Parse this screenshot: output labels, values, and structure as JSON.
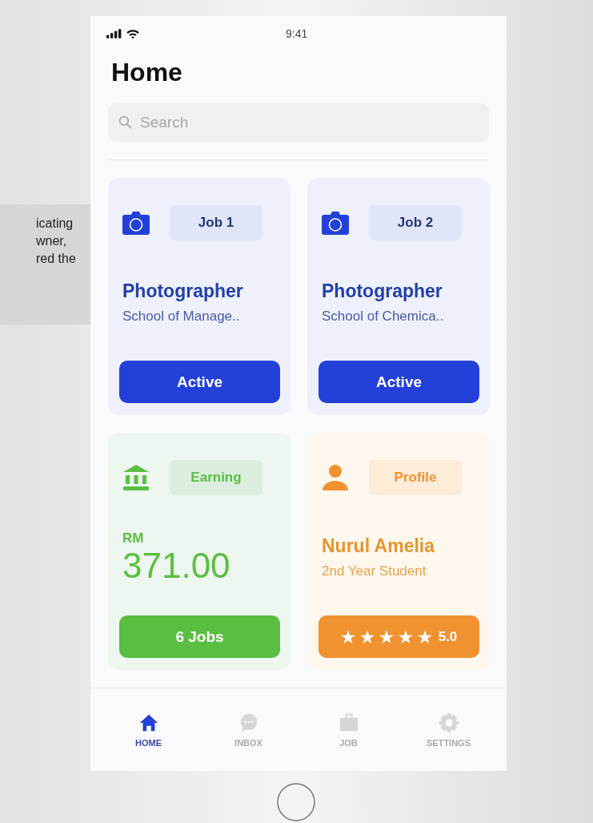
{
  "callout": {
    "lines": [
      "icating",
      "wner,",
      "red the"
    ]
  },
  "status_bar": {
    "time": "9:41"
  },
  "title": "Home",
  "search": {
    "placeholder": "Search"
  },
  "cards": [
    {
      "kind": "job",
      "tag": "Job 1",
      "title": "Photographer",
      "subtitle": "School of Manage..",
      "button": "Active",
      "color": "#2340d8"
    },
    {
      "kind": "job",
      "tag": "Job 2",
      "title": "Photographer",
      "subtitle": "School of Chemica..",
      "button": "Active",
      "color": "#2340d8"
    },
    {
      "kind": "earning",
      "tag": "Earning",
      "currency": "RM",
      "amount": "371.00",
      "button": "6 Jobs",
      "color": "#5abf41"
    },
    {
      "kind": "profile",
      "tag": "Profile",
      "title": "Nurul Amelia",
      "subtitle": "2nd Year Student",
      "stars": 5,
      "rating": "5.0",
      "color": "#f0922f"
    }
  ],
  "nav": [
    {
      "label": "HOME",
      "selected": true
    },
    {
      "label": "INBOX",
      "selected": false
    },
    {
      "label": "JOB",
      "selected": false
    },
    {
      "label": "SETTINGS",
      "selected": false
    }
  ]
}
